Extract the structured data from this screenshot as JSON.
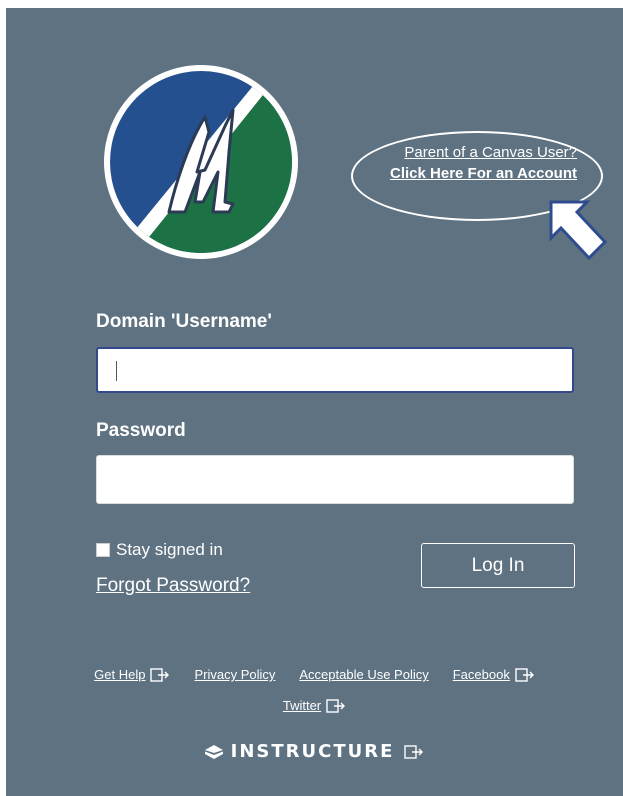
{
  "logo": {
    "name": "m-logo",
    "colors": [
      "#25508f",
      "#1c7244",
      "#ffffff"
    ]
  },
  "parent_callout": {
    "line1": "Parent of a Canvas User?",
    "line2": "Click Here For an Account"
  },
  "login_form": {
    "username_label": "Domain 'Username'",
    "username_value": "",
    "password_label": "Password",
    "password_value": "",
    "stay_signed_in_label": "Stay signed in",
    "stay_signed_in_checked": false,
    "forgot_password": "Forgot Password?",
    "login_button": "Log In"
  },
  "footer": {
    "links": [
      {
        "label": "Get Help",
        "external": true
      },
      {
        "label": "Privacy Policy",
        "external": false
      },
      {
        "label": "Acceptable Use Policy",
        "external": false
      },
      {
        "label": "Facebook",
        "external": true
      },
      {
        "label": "Twitter",
        "external": true
      }
    ],
    "brand": "INSTRUCTURE"
  },
  "colors": {
    "panel_background": "#5e7282",
    "text": "#ffffff",
    "input_focus_border": "#34488e"
  }
}
